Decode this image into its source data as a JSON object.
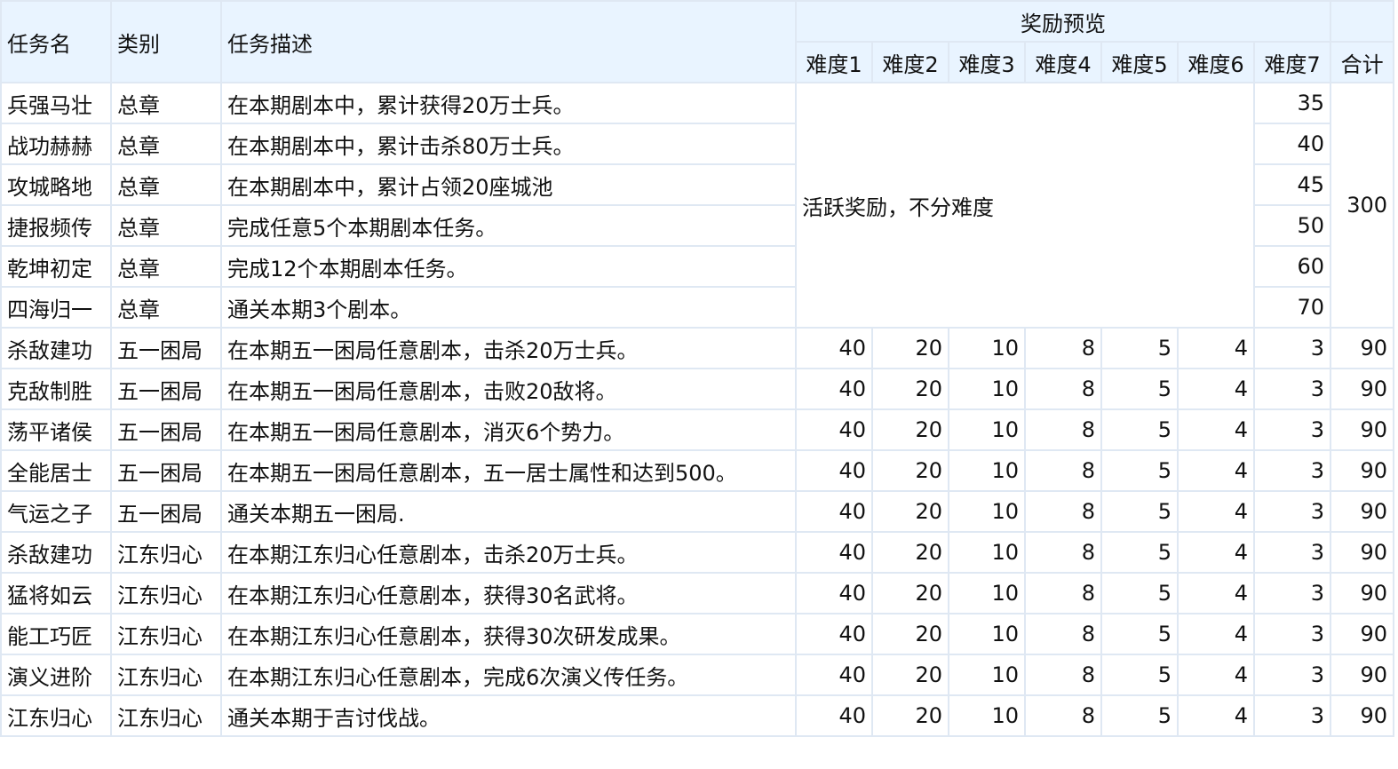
{
  "header": {
    "task_name": "任务名",
    "category": "类别",
    "description": "任务描述",
    "reward_preview": "奖励预览",
    "difficulties": [
      "难度1",
      "难度2",
      "难度3",
      "难度4",
      "难度5",
      "难度6",
      "难度7"
    ],
    "total": "合计"
  },
  "active_group": {
    "note": "活跃奖励，不分难度",
    "total": "300",
    "rows": [
      {
        "name": "兵强马壮",
        "category": "总章",
        "description": "在本期剧本中，累计获得20万士兵。",
        "reward": "35"
      },
      {
        "name": "战功赫赫",
        "category": "总章",
        "description": "在本期剧本中，累计击杀80万士兵。",
        "reward": "40"
      },
      {
        "name": "攻城略地",
        "category": "总章",
        "description": "在本期剧本中，累计占领20座城池",
        "reward": "45"
      },
      {
        "name": "捷报频传",
        "category": "总章",
        "description": "完成任意5个本期剧本任务。",
        "reward": "50"
      },
      {
        "name": "乾坤初定",
        "category": "总章",
        "description": "完成12个本期剧本任务。",
        "reward": "60"
      },
      {
        "name": "四海归一",
        "category": "总章",
        "description": "通关本期3个剧本。",
        "reward": "70"
      }
    ]
  },
  "rows": [
    {
      "name": "杀敌建功",
      "category": "五一困局",
      "description": "在本期五一困局任意剧本，击杀20万士兵。",
      "values": [
        "40",
        "20",
        "10",
        "8",
        "5",
        "4",
        "3"
      ],
      "total": "90"
    },
    {
      "name": "克敌制胜",
      "category": "五一困局",
      "description": "在本期五一困局任意剧本，击败20敌将。",
      "values": [
        "40",
        "20",
        "10",
        "8",
        "5",
        "4",
        "3"
      ],
      "total": "90"
    },
    {
      "name": "荡平诸侯",
      "category": "五一困局",
      "description": "在本期五一困局任意剧本，消灭6个势力。",
      "values": [
        "40",
        "20",
        "10",
        "8",
        "5",
        "4",
        "3"
      ],
      "total": "90"
    },
    {
      "name": "全能居士",
      "category": "五一困局",
      "description": "在本期五一困局任意剧本，五一居士属性和达到500。",
      "values": [
        "40",
        "20",
        "10",
        "8",
        "5",
        "4",
        "3"
      ],
      "total": "90"
    },
    {
      "name": "气运之子",
      "category": "五一困局",
      "description": "通关本期五一困局.",
      "values": [
        "40",
        "20",
        "10",
        "8",
        "5",
        "4",
        "3"
      ],
      "total": "90"
    },
    {
      "name": "杀敌建功",
      "category": "江东归心",
      "description": "在本期江东归心任意剧本，击杀20万士兵。",
      "values": [
        "40",
        "20",
        "10",
        "8",
        "5",
        "4",
        "3"
      ],
      "total": "90"
    },
    {
      "name": "猛将如云",
      "category": "江东归心",
      "description": "在本期江东归心任意剧本，获得30名武将。",
      "values": [
        "40",
        "20",
        "10",
        "8",
        "5",
        "4",
        "3"
      ],
      "total": "90"
    },
    {
      "name": "能工巧匠",
      "category": "江东归心",
      "description": "在本期江东归心任意剧本，获得30次研发成果。",
      "values": [
        "40",
        "20",
        "10",
        "8",
        "5",
        "4",
        "3"
      ],
      "total": "90"
    },
    {
      "name": "演义进阶",
      "category": "江东归心",
      "description": "在本期江东归心任意剧本，完成6次演义传任务。",
      "values": [
        "40",
        "20",
        "10",
        "8",
        "5",
        "4",
        "3"
      ],
      "total": "90"
    },
    {
      "name": "江东归心",
      "category": "江东归心",
      "description": "通关本期于吉讨伐战。",
      "values": [
        "40",
        "20",
        "10",
        "8",
        "5",
        "4",
        "3"
      ],
      "total": "90"
    }
  ]
}
